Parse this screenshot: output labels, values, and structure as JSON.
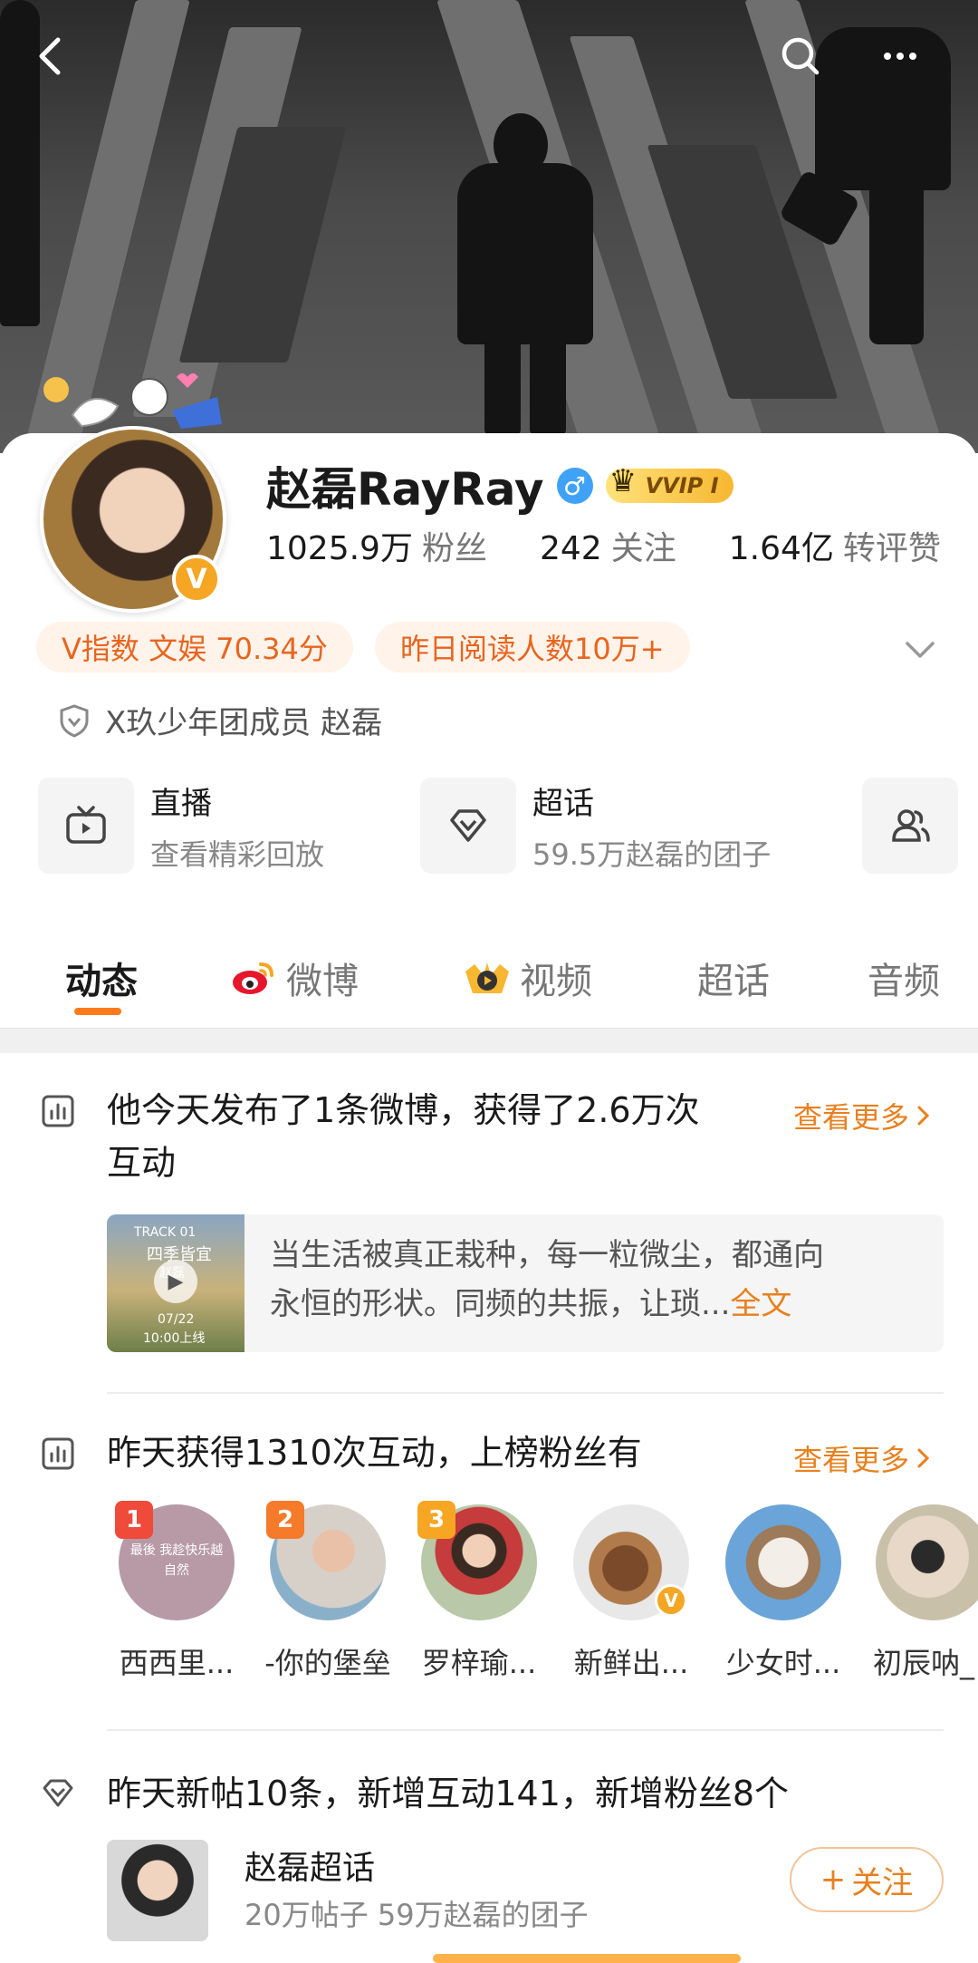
{
  "profile": {
    "name": "赵磊RayRay",
    "gender_symbol": "♂",
    "vvip": "VVIP I",
    "verified_mark": "V",
    "stats": [
      {
        "num": "1025.9万",
        "label": "粉丝"
      },
      {
        "num": "242",
        "label": "关注"
      },
      {
        "num": "1.64亿",
        "label": "转评赞"
      }
    ],
    "pills": [
      "V指数 文娱 70.34分",
      "昨日阅读人数10万+"
    ],
    "verification": "X玖少年团成员 赵磊"
  },
  "services": [
    {
      "title": "直播",
      "subtitle": "查看精彩回放",
      "icon": "tv-icon"
    },
    {
      "title": "超话",
      "subtitle": "59.5万赵磊的团子",
      "icon": "diamond-icon"
    },
    {
      "title": "",
      "subtitle": "",
      "icon": "group-icon"
    }
  ],
  "tabs": [
    "动态",
    "微博",
    "视频",
    "超话",
    "音频"
  ],
  "section1": {
    "title_line1": "他今天发布了1条微博，获得了2.6万次",
    "title_line2": "互动",
    "more": "查看更多",
    "post_line1": "当生活被真正栽种，每一粒微尘，都通向",
    "post_line2": "永恒的形状。同频的共振，让琐...",
    "post_more": "全文",
    "thumb_top": "TRACK 01",
    "thumb_title": "四季皆宜",
    "thumb_artist": "赵磊",
    "thumb_date": "07/22",
    "thumb_time": "10:00上线"
  },
  "section2": {
    "title": "昨天获得1310次互动，上榜粉丝有",
    "more": "查看更多",
    "fans": [
      {
        "name": "西西里...",
        "rank": "1"
      },
      {
        "name": "-你的堡垒",
        "rank": "2"
      },
      {
        "name": "罗梓瑜...",
        "rank": "3"
      },
      {
        "name": "新鲜出...",
        "rank": ""
      },
      {
        "name": "少女时...",
        "rank": ""
      },
      {
        "name": "初辰呐_",
        "rank": ""
      }
    ],
    "fan1_text": "最後 我趁快乐越自然"
  },
  "section3": {
    "title": "昨天新帖10条，新增互动141，新增粉丝8个",
    "topic_name": "赵磊超话",
    "topic_stats": "20万帖子 59万赵磊的团子",
    "follow": "关注",
    "follow_plus": "+"
  },
  "colors": {
    "accent": "#e8801e",
    "vvip": "#f7b731",
    "tab_underline": "#ff7a1a"
  }
}
